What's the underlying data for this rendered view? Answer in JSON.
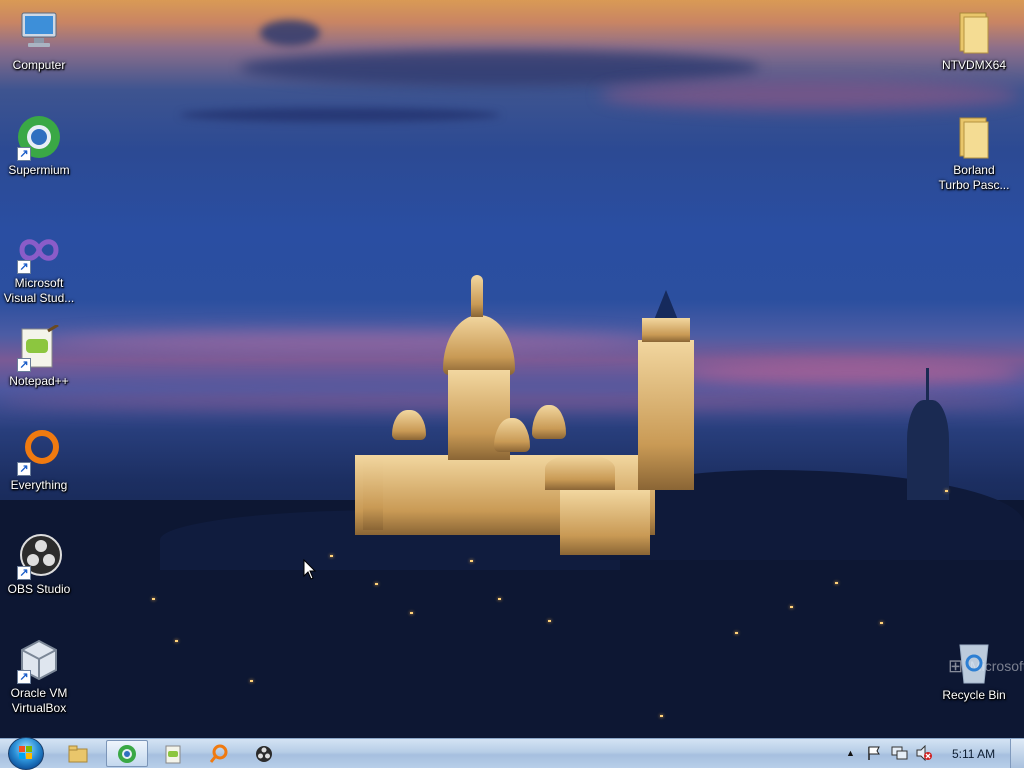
{
  "desktop": {
    "icons_left": [
      {
        "label": "Computer",
        "icon": "computer-icon"
      },
      {
        "label": "Supermium",
        "icon": "supermium-icon"
      },
      {
        "label": "Microsoft\nVisual Stud...",
        "icon": "visual-studio-icon"
      },
      {
        "label": "Notepad++",
        "icon": "notepad-plus-plus-icon"
      },
      {
        "label": "Everything",
        "icon": "everything-search-icon"
      },
      {
        "label": "OBS Studio",
        "icon": "obs-studio-icon"
      },
      {
        "label": "Oracle VM\nVirtualBox",
        "icon": "virtualbox-icon"
      }
    ],
    "icons_right": [
      {
        "label": "NTVDMX64",
        "icon": "folder-icon"
      },
      {
        "label": "Borland\nTurbo Pasc...",
        "icon": "folder-icon"
      },
      {
        "label": "Recycle Bin",
        "icon": "recycle-bin-icon"
      }
    ],
    "watermark_text": "Microsoft"
  },
  "taskbar": {
    "start": "start-orb-icon",
    "pinned": [
      {
        "name": "file-explorer-icon",
        "active": false
      },
      {
        "name": "supermium-icon",
        "active": true
      },
      {
        "name": "notepad-plus-plus-icon",
        "active": false
      },
      {
        "name": "everything-search-icon",
        "active": false
      },
      {
        "name": "obs-studio-icon",
        "active": false
      }
    ],
    "tray": {
      "overflow_arrow": "▲",
      "icons": [
        "action-center-flag-icon",
        "network-icon",
        "volume-muted-icon"
      ],
      "clock": "5:11 AM"
    }
  },
  "colors": {
    "taskbar_top": "#d3e3f4",
    "sky_top": "#d99a55",
    "sky_mid": "#2b4f9f",
    "night": "#0a1128"
  }
}
